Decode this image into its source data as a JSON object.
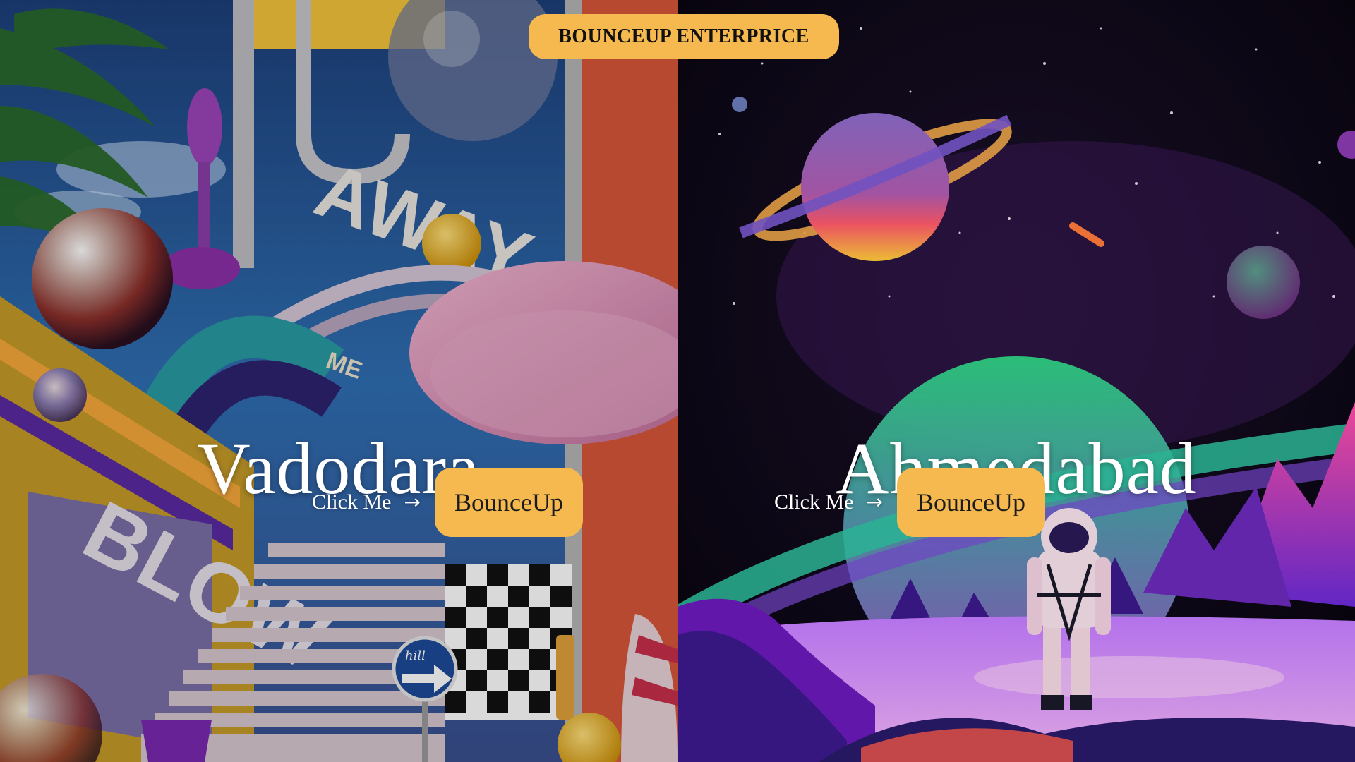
{
  "brand": {
    "label": "BOUNCEUP ENTERPRICE",
    "color": "#f5b94f"
  },
  "panels": [
    {
      "city": "Vadodara",
      "link_label": "Click Me",
      "link_icon": "right-arrow-icon",
      "button_label": "BounceUp",
      "artwork_lettering": [
        "AWAY",
        "ME",
        "BLOW",
        "hill"
      ]
    },
    {
      "city": "Ahmedabad",
      "link_label": "Click Me",
      "link_icon": "right-arrow-icon",
      "button_label": "BounceUp"
    }
  ],
  "colors": {
    "accent": "#f5b94f",
    "text_light": "#ffffff",
    "button_text": "#1b1b1b"
  }
}
